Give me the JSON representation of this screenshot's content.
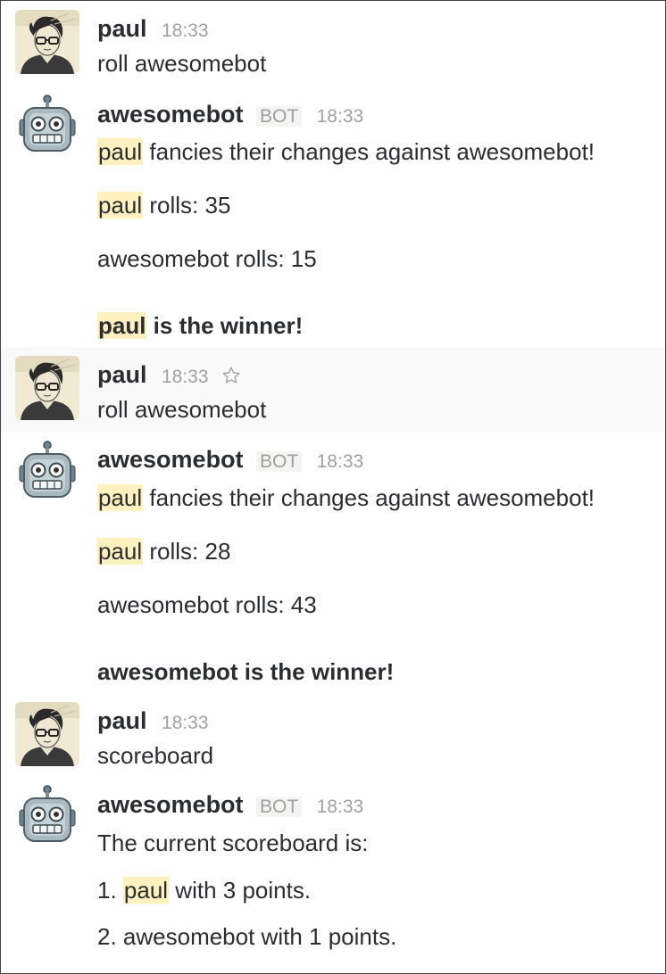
{
  "messages": [
    {
      "author": "paul",
      "time": "18:33",
      "lines": [
        "roll awesomebot"
      ]
    },
    {
      "author": "awesomebot",
      "badge": "BOT",
      "time": "18:33",
      "mention": "paul",
      "lines": [
        " fancies their changes against awesomebot!",
        " rolls: 35",
        "awesomebot rolls: 15",
        " is the winner!"
      ]
    },
    {
      "author": "paul",
      "time": "18:33",
      "lines": [
        "roll awesomebot"
      ]
    },
    {
      "author": "awesomebot",
      "badge": "BOT",
      "time": "18:33",
      "mention": "paul",
      "lines": [
        " fancies their changes against awesomebot!",
        " rolls: 28",
        "awesomebot rolls: 43",
        "awesomebot is the winner!"
      ]
    },
    {
      "author": "paul",
      "time": "18:33",
      "lines": [
        "scoreboard"
      ]
    },
    {
      "author": "awesomebot",
      "badge": "BOT",
      "time": "18:33",
      "mention": "paul",
      "lines": [
        "The current scoreboard is:",
        "1. ",
        " with 3 points.",
        "2. awesomebot with 1 points."
      ]
    }
  ],
  "icons": {
    "user_avatar": "paul-avatar-icon",
    "bot_avatar": "robot-avatar-icon",
    "star": "star-icon"
  },
  "colors": {
    "mention_highlight": "#fff0c0",
    "timestamp": "#a0a0a2",
    "hover_background": "#f9f9f9"
  }
}
